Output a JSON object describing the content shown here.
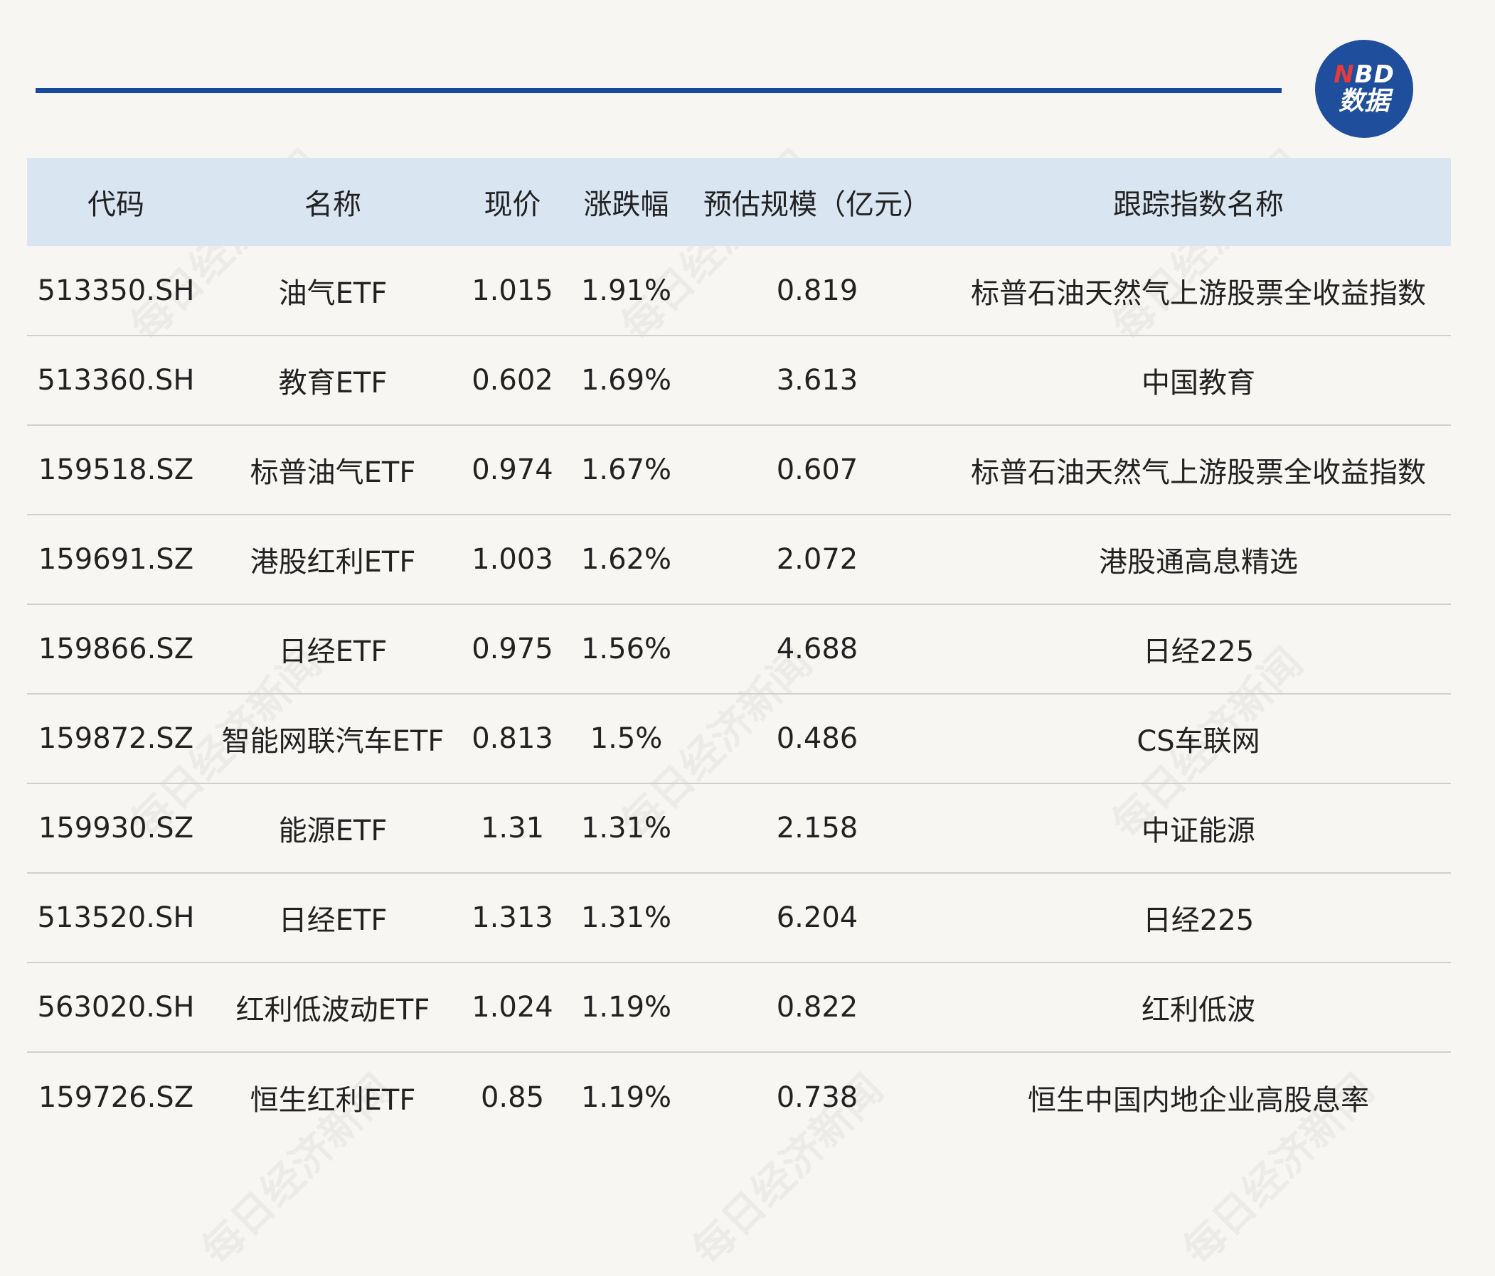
{
  "brand": {
    "logo_line1_n": "N",
    "logo_line1_rest": "BD",
    "logo_line2": "数据",
    "brand_color": "#1f4e9c",
    "accent_red": "#e23b3b"
  },
  "watermark_text": "每日经济新闻",
  "table": {
    "headers": [
      "代码",
      "名称",
      "现价",
      "涨跌幅",
      "预估规模（亿元）",
      "跟踪指数名称"
    ],
    "rows": [
      [
        "513350.SH",
        "油气ETF",
        "1.015",
        "1.91%",
        "0.819",
        "标普石油天然气上游股票全收益指数"
      ],
      [
        "513360.SH",
        "教育ETF",
        "0.602",
        "1.69%",
        "3.613",
        "中国教育"
      ],
      [
        "159518.SZ",
        "标普油气ETF",
        "0.974",
        "1.67%",
        "0.607",
        "标普石油天然气上游股票全收益指数"
      ],
      [
        "159691.SZ",
        "港股红利ETF",
        "1.003",
        "1.62%",
        "2.072",
        "港股通高息精选"
      ],
      [
        "159866.SZ",
        "日经ETF",
        "0.975",
        "1.56%",
        "4.688",
        "日经225"
      ],
      [
        "159872.SZ",
        "智能网联汽车ETF",
        "0.813",
        "1.5%",
        "0.486",
        "CS车联网"
      ],
      [
        "159930.SZ",
        "能源ETF",
        "1.31",
        "1.31%",
        "2.158",
        "中证能源"
      ],
      [
        "513520.SH",
        "日经ETF",
        "1.313",
        "1.31%",
        "6.204",
        "日经225"
      ],
      [
        "563020.SH",
        "红利低波动ETF",
        "1.024",
        "1.19%",
        "0.822",
        "红利低波"
      ],
      [
        "159726.SZ",
        "恒生红利ETF",
        "0.85",
        "1.19%",
        "0.738",
        "恒生中国内地企业高股息率"
      ]
    ]
  }
}
